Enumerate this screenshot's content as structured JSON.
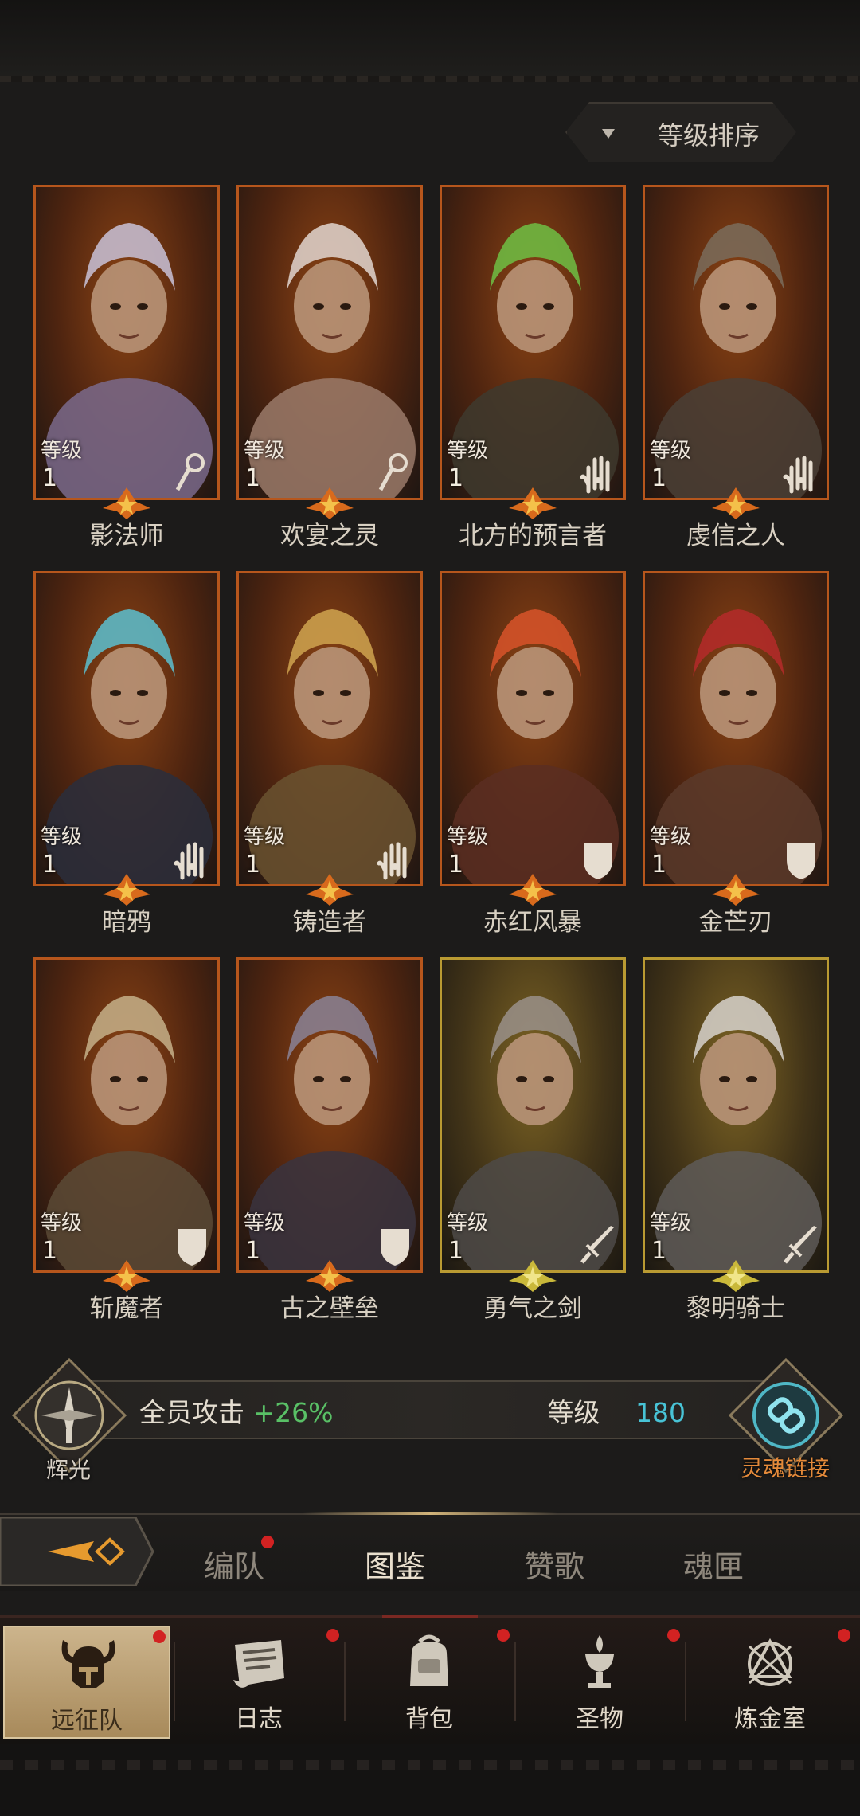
{
  "sort": {
    "label": "等级排序"
  },
  "level_label": "等级",
  "heroes": [
    {
      "name": "影法师",
      "level": "1",
      "class_icon": "staff-icon",
      "rarity": "orange"
    },
    {
      "name": "欢宴之灵",
      "level": "1",
      "class_icon": "staff-icon",
      "rarity": "orange"
    },
    {
      "name": "北方的预言者",
      "level": "1",
      "class_icon": "hand-icon",
      "rarity": "orange"
    },
    {
      "name": "虔信之人",
      "level": "1",
      "class_icon": "hand-icon",
      "rarity": "orange"
    },
    {
      "name": "暗鸦",
      "level": "1",
      "class_icon": "hand-icon",
      "rarity": "orange"
    },
    {
      "name": "铸造者",
      "level": "1",
      "class_icon": "hand-icon",
      "rarity": "orange"
    },
    {
      "name": "赤红风暴",
      "level": "1",
      "class_icon": "shield-icon",
      "rarity": "orange"
    },
    {
      "name": "金芒刃",
      "level": "1",
      "class_icon": "shield-icon",
      "rarity": "orange"
    },
    {
      "name": "斩魔者",
      "level": "1",
      "class_icon": "shield-icon",
      "rarity": "orange"
    },
    {
      "name": "古之壁垒",
      "level": "1",
      "class_icon": "shield-icon",
      "rarity": "orange"
    },
    {
      "name": "勇气之剑",
      "level": "1",
      "class_icon": "sword-icon",
      "rarity": "gold"
    },
    {
      "name": "黎明骑士",
      "level": "1",
      "class_icon": "sword-icon",
      "rarity": "gold"
    }
  ],
  "stats": {
    "radiance_label": "辉光",
    "attack_label": "全员攻击",
    "attack_value": "+26%",
    "level_label": "等级",
    "level_value": "180",
    "soul_link_label": "灵魂链接"
  },
  "subtabs": [
    {
      "label": "编队",
      "dot": true
    },
    {
      "label": "图鉴",
      "dot": false,
      "active": true
    },
    {
      "label": "赞歌",
      "dot": false
    },
    {
      "label": "魂匣",
      "dot": false
    }
  ],
  "nav": [
    {
      "label": "远征队",
      "icon": "viking-helmet-icon",
      "dot": true,
      "active": true
    },
    {
      "label": "日志",
      "icon": "scroll-icon",
      "dot": true
    },
    {
      "label": "背包",
      "icon": "backpack-icon",
      "dot": true
    },
    {
      "label": "圣物",
      "icon": "chalice-icon",
      "dot": true
    },
    {
      "label": "炼金室",
      "icon": "alchemy-icon",
      "dot": true
    }
  ],
  "colors": {
    "accent_green": "#59c066",
    "accent_cyan": "#48c3d6",
    "notify_red": "#d22222",
    "frame_orange": "#b6561c",
    "frame_gold": "#b99a32"
  }
}
